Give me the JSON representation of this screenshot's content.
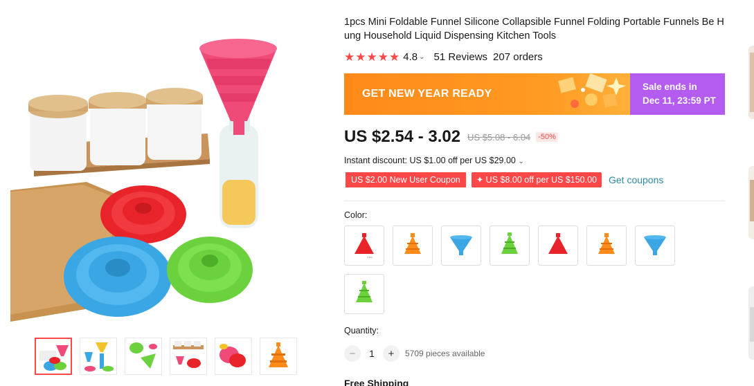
{
  "product": {
    "title": "1pcs Mini Foldable Funnel Silicone Collapsible Funnel Folding Portable Funnels Be Hung Household Liquid Dispensing Kitchen Tools",
    "rating": "4.8",
    "rating_chevron": "⌄",
    "reviews": "51 Reviews",
    "orders": "207 orders",
    "stars": 5
  },
  "banner": {
    "promo_text": "GET NEW YEAR READY",
    "sale_line1": "Sale ends in",
    "sale_line2": "Dec 11, 23:59 PT"
  },
  "price": {
    "current": "US $2.54 - 3.02",
    "original": "US $5.08 - 6.04",
    "discount": "-50%"
  },
  "discounts": {
    "instant": "Instant discount: US $1.00 off per US $29.00",
    "instant_chevron": "⌄",
    "coupon1": "US $2.00 New User Coupon",
    "coupon2": "✦ US $8.00 off per US $150.00",
    "get_coupons": "Get coupons"
  },
  "color": {
    "label": "Color:",
    "options": [
      "red",
      "orange",
      "blue",
      "green",
      "red",
      "orange",
      "blue",
      "green"
    ]
  },
  "quantity": {
    "label": "Quantity:",
    "value": "1",
    "minus": "−",
    "plus": "+",
    "available": "5709 pieces available"
  },
  "shipping": "Free Shipping",
  "colors": {
    "accent_red": "#ff4747",
    "banner_orange": "#ff8a1a",
    "banner_purple": "#b45cf0",
    "link_teal": "#2e8ba3"
  }
}
